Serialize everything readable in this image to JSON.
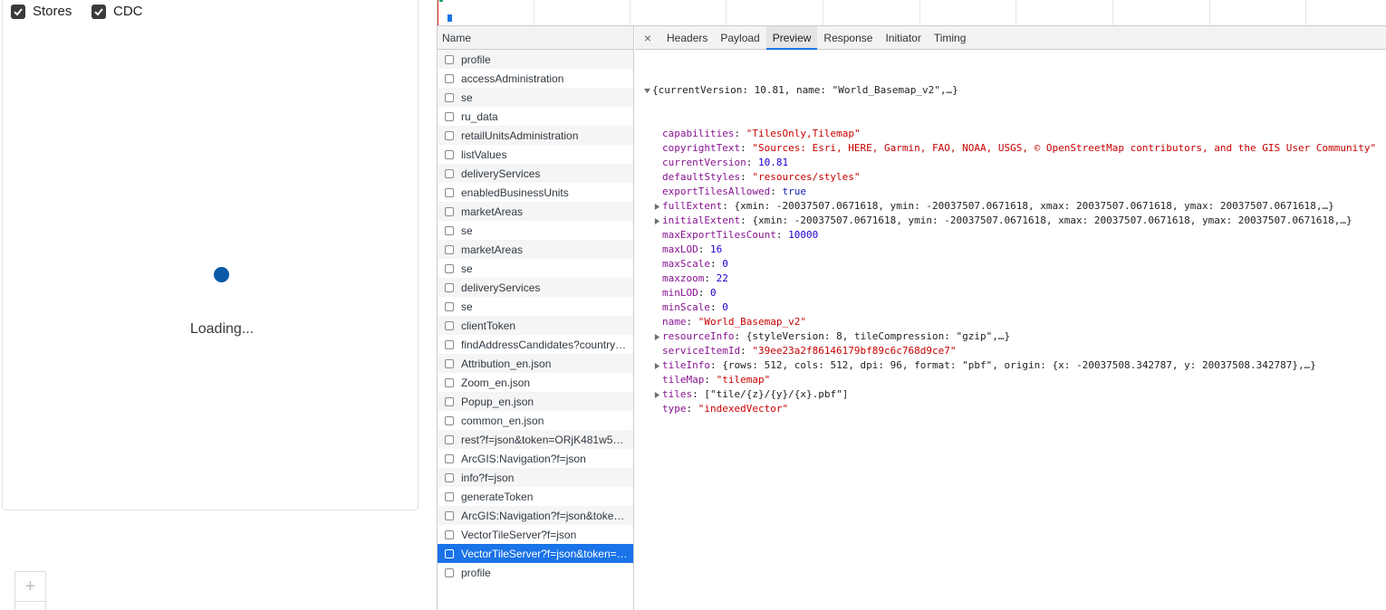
{
  "app": {
    "layers": [
      {
        "label": "Stores",
        "checked": true
      },
      {
        "label": "CDC",
        "checked": true
      }
    ],
    "loading_text": "Loading...",
    "zoom_in_label": "+"
  },
  "devtools": {
    "name_header": "Name",
    "requests": [
      "profile",
      "accessAdministration",
      "se",
      "ru_data",
      "retailUnitsAdministration",
      "listValues",
      "deliveryServices",
      "enabledBusinessUnits",
      "marketAreas",
      "se",
      "marketAreas",
      "se",
      "deliveryServices",
      "se",
      "clientToken",
      "findAddressCandidates?country…",
      "Attribution_en.json",
      "Zoom_en.json",
      "Popup_en.json",
      "common_en.json",
      "rest?f=json&token=ORjK481w5…",
      "ArcGIS:Navigation?f=json",
      "info?f=json",
      "generateToken",
      "ArcGIS:Navigation?f=json&toke…",
      "VectorTileServer?f=json",
      "VectorTileServer?f=json&token=…",
      "profile"
    ],
    "selected_request_index": 26,
    "tabs": [
      "Headers",
      "Payload",
      "Preview",
      "Response",
      "Initiator",
      "Timing"
    ],
    "active_tab": "Preview",
    "close_glyph": "×",
    "preview": {
      "summary": "{currentVersion: 10.81, name: \"World_Basemap_v2\",…}",
      "entries": [
        {
          "key": "capabilities",
          "value": "\"TilesOnly,Tilemap\"",
          "type": "str",
          "expandable": false
        },
        {
          "key": "copyrightText",
          "value": "\"Sources: Esri, HERE, Garmin, FAO, NOAA, USGS, © OpenStreetMap contributors, and the GIS User Community\"",
          "type": "str",
          "expandable": false
        },
        {
          "key": "currentVersion",
          "value": "10.81",
          "type": "num",
          "expandable": false
        },
        {
          "key": "defaultStyles",
          "value": "\"resources/styles\"",
          "type": "str",
          "expandable": false
        },
        {
          "key": "exportTilesAllowed",
          "value": "true",
          "type": "bool",
          "expandable": false
        },
        {
          "key": "fullExtent",
          "value": "{xmin: -20037507.0671618, ymin: -20037507.0671618, xmax: 20037507.0671618, ymax: 20037507.0671618,…}",
          "type": "plain",
          "expandable": true
        },
        {
          "key": "initialExtent",
          "value": "{xmin: -20037507.0671618, ymin: -20037507.0671618, xmax: 20037507.0671618, ymax: 20037507.0671618,…}",
          "type": "plain",
          "expandable": true
        },
        {
          "key": "maxExportTilesCount",
          "value": "10000",
          "type": "num",
          "expandable": false
        },
        {
          "key": "maxLOD",
          "value": "16",
          "type": "num",
          "expandable": false
        },
        {
          "key": "maxScale",
          "value": "0",
          "type": "num",
          "expandable": false
        },
        {
          "key": "maxzoom",
          "value": "22",
          "type": "num",
          "expandable": false
        },
        {
          "key": "minLOD",
          "value": "0",
          "type": "num",
          "expandable": false
        },
        {
          "key": "minScale",
          "value": "0",
          "type": "num",
          "expandable": false
        },
        {
          "key": "name",
          "value": "\"World_Basemap_v2\"",
          "type": "str",
          "expandable": false
        },
        {
          "key": "resourceInfo",
          "value": "{styleVersion: 8, tileCompression: \"gzip\",…}",
          "type": "plain",
          "expandable": true
        },
        {
          "key": "serviceItemId",
          "value": "\"39ee23a2f86146179bf89c6c768d9ce7\"",
          "type": "str",
          "expandable": false
        },
        {
          "key": "tileInfo",
          "value": "{rows: 512, cols: 512, dpi: 96, format: \"pbf\", origin: {x: -20037508.342787, y: 20037508.342787},…}",
          "type": "plain",
          "expandable": true
        },
        {
          "key": "tileMap",
          "value": "\"tilemap\"",
          "type": "str",
          "expandable": false
        },
        {
          "key": "tiles",
          "value": "[\"tile/{z}/{y}/{x}.pbf\"]",
          "type": "plain",
          "expandable": true
        },
        {
          "key": "type",
          "value": "\"indexedVector\"",
          "type": "str",
          "expandable": false
        }
      ]
    }
  },
  "colors": {
    "accent": "#1a73e8",
    "spinner": "#0a5aa8",
    "json_key": "#881391",
    "json_string": "#c80000",
    "json_number": "#1c00cf"
  }
}
